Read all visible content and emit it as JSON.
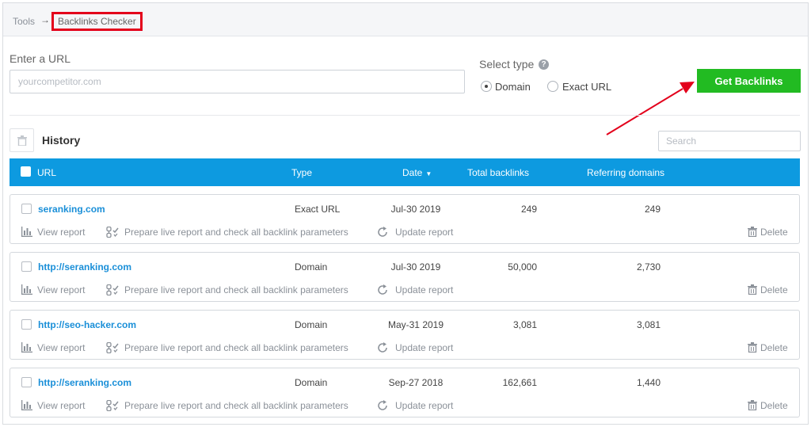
{
  "breadcrumb": {
    "root": "Tools",
    "separator": "→",
    "current": "Backlinks Checker"
  },
  "url_form": {
    "label": "Enter a URL",
    "placeholder": "yourcompetitor.com",
    "value": ""
  },
  "select_type": {
    "label": "Select type",
    "options": [
      {
        "label": "Domain",
        "selected": true
      },
      {
        "label": "Exact URL",
        "selected": false
      }
    ]
  },
  "get_button": "Get Backlinks",
  "history": {
    "title": "History",
    "search_placeholder": "Search"
  },
  "table": {
    "headers": {
      "url": "URL",
      "type": "Type",
      "date": "Date",
      "total": "Total backlinks",
      "referring": "Referring domains"
    },
    "actions": {
      "view": "View report",
      "prepare": "Prepare live report and check all backlink parameters",
      "update": "Update report",
      "delete": "Delete"
    },
    "rows": [
      {
        "url": "seranking.com",
        "type": "Exact URL",
        "date": "Jul-30 2019",
        "total": "249",
        "referring": "249"
      },
      {
        "url": "http://seranking.com",
        "type": "Domain",
        "date": "Jul-30 2019",
        "total": "50,000",
        "referring": "2,730"
      },
      {
        "url": "http://seo-hacker.com",
        "type": "Domain",
        "date": "May-31 2019",
        "total": "3,081",
        "referring": "3,081"
      },
      {
        "url": "http://seranking.com",
        "type": "Domain",
        "date": "Sep-27 2018",
        "total": "162,661",
        "referring": "1,440"
      }
    ]
  },
  "colors": {
    "header_blue": "#0d9ae0",
    "button_green": "#22bb22",
    "link_blue": "#1a8fd8",
    "highlight_red": "#e3001b"
  }
}
